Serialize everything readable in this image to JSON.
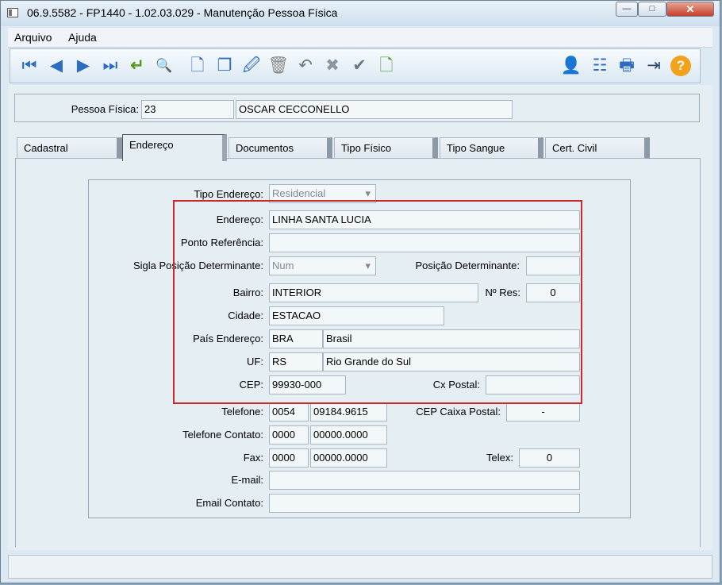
{
  "window": {
    "title": "06.9.5582 - FP1440 - 1.02.03.029 - Manutenção Pessoa Física",
    "min": "—",
    "max": "□",
    "close": "✕"
  },
  "menu": {
    "arquivo": "Arquivo",
    "ajuda": "Ajuda"
  },
  "toolbar_icons": {
    "first": "⏮",
    "prev": "◀",
    "next": "▶",
    "last": "⏭",
    "goto": "↵",
    "search": "🔍",
    "new": "🗋",
    "copy": "❐",
    "edit": "🖉",
    "delete": "🗑",
    "undo": "↶",
    "cancel": "✖",
    "save": "✔",
    "blank": "🗋",
    "user": "👤",
    "tree": "☷",
    "print": "🖶",
    "exit": "⇥",
    "help": "?"
  },
  "person": {
    "label": "Pessoa Física:",
    "code": "23",
    "name": "OSCAR CECCONELLO"
  },
  "tabs": [
    "Cadastral",
    "Endereço",
    "Documentos",
    "Tipo Físico",
    "Tipo Sangue",
    "Cert. Civil"
  ],
  "form": {
    "tipo_endereco": {
      "label": "Tipo Endereço:",
      "value": "Residencial"
    },
    "endereco": {
      "label": "Endereço:",
      "value": "LINHA SANTA LUCIA"
    },
    "ponto_referencia": {
      "label": "Ponto Referência:",
      "value": ""
    },
    "sigla_posicao": {
      "label": "Sigla Posição Determinante:",
      "value": "Num"
    },
    "posicao_determinante": {
      "label": "Posição Determinante:",
      "value": ""
    },
    "bairro": {
      "label": "Bairro:",
      "value": "INTERIOR"
    },
    "numero_res": {
      "label": "Nº Res:",
      "value": "0"
    },
    "cidade": {
      "label": "Cidade:",
      "value": "ESTACAO"
    },
    "pais": {
      "label": "País Endereço:",
      "code": "BRA",
      "name": "Brasil"
    },
    "uf": {
      "label": "UF:",
      "code": "RS",
      "name": "Rio Grande do Sul"
    },
    "cep": {
      "label": "CEP:",
      "value": "99930-000"
    },
    "cx_postal": {
      "label": "Cx Postal:",
      "value": ""
    },
    "telefone": {
      "label": "Telefone:",
      "ddd": "0054",
      "number": "09184.9615"
    },
    "cep_cx_postal": {
      "label": "CEP Caixa Postal:",
      "value": "-"
    },
    "telefone_contato": {
      "label": "Telefone Contato:",
      "ddd": "0000",
      "number": "00000.0000"
    },
    "fax": {
      "label": "Fax:",
      "ddd": "0000",
      "number": "00000.0000"
    },
    "telex": {
      "label": "Telex:",
      "value": "0"
    },
    "email": {
      "label": "E-mail:",
      "value": ""
    },
    "email_contato": {
      "label": "Email Contato:",
      "value": ""
    }
  }
}
